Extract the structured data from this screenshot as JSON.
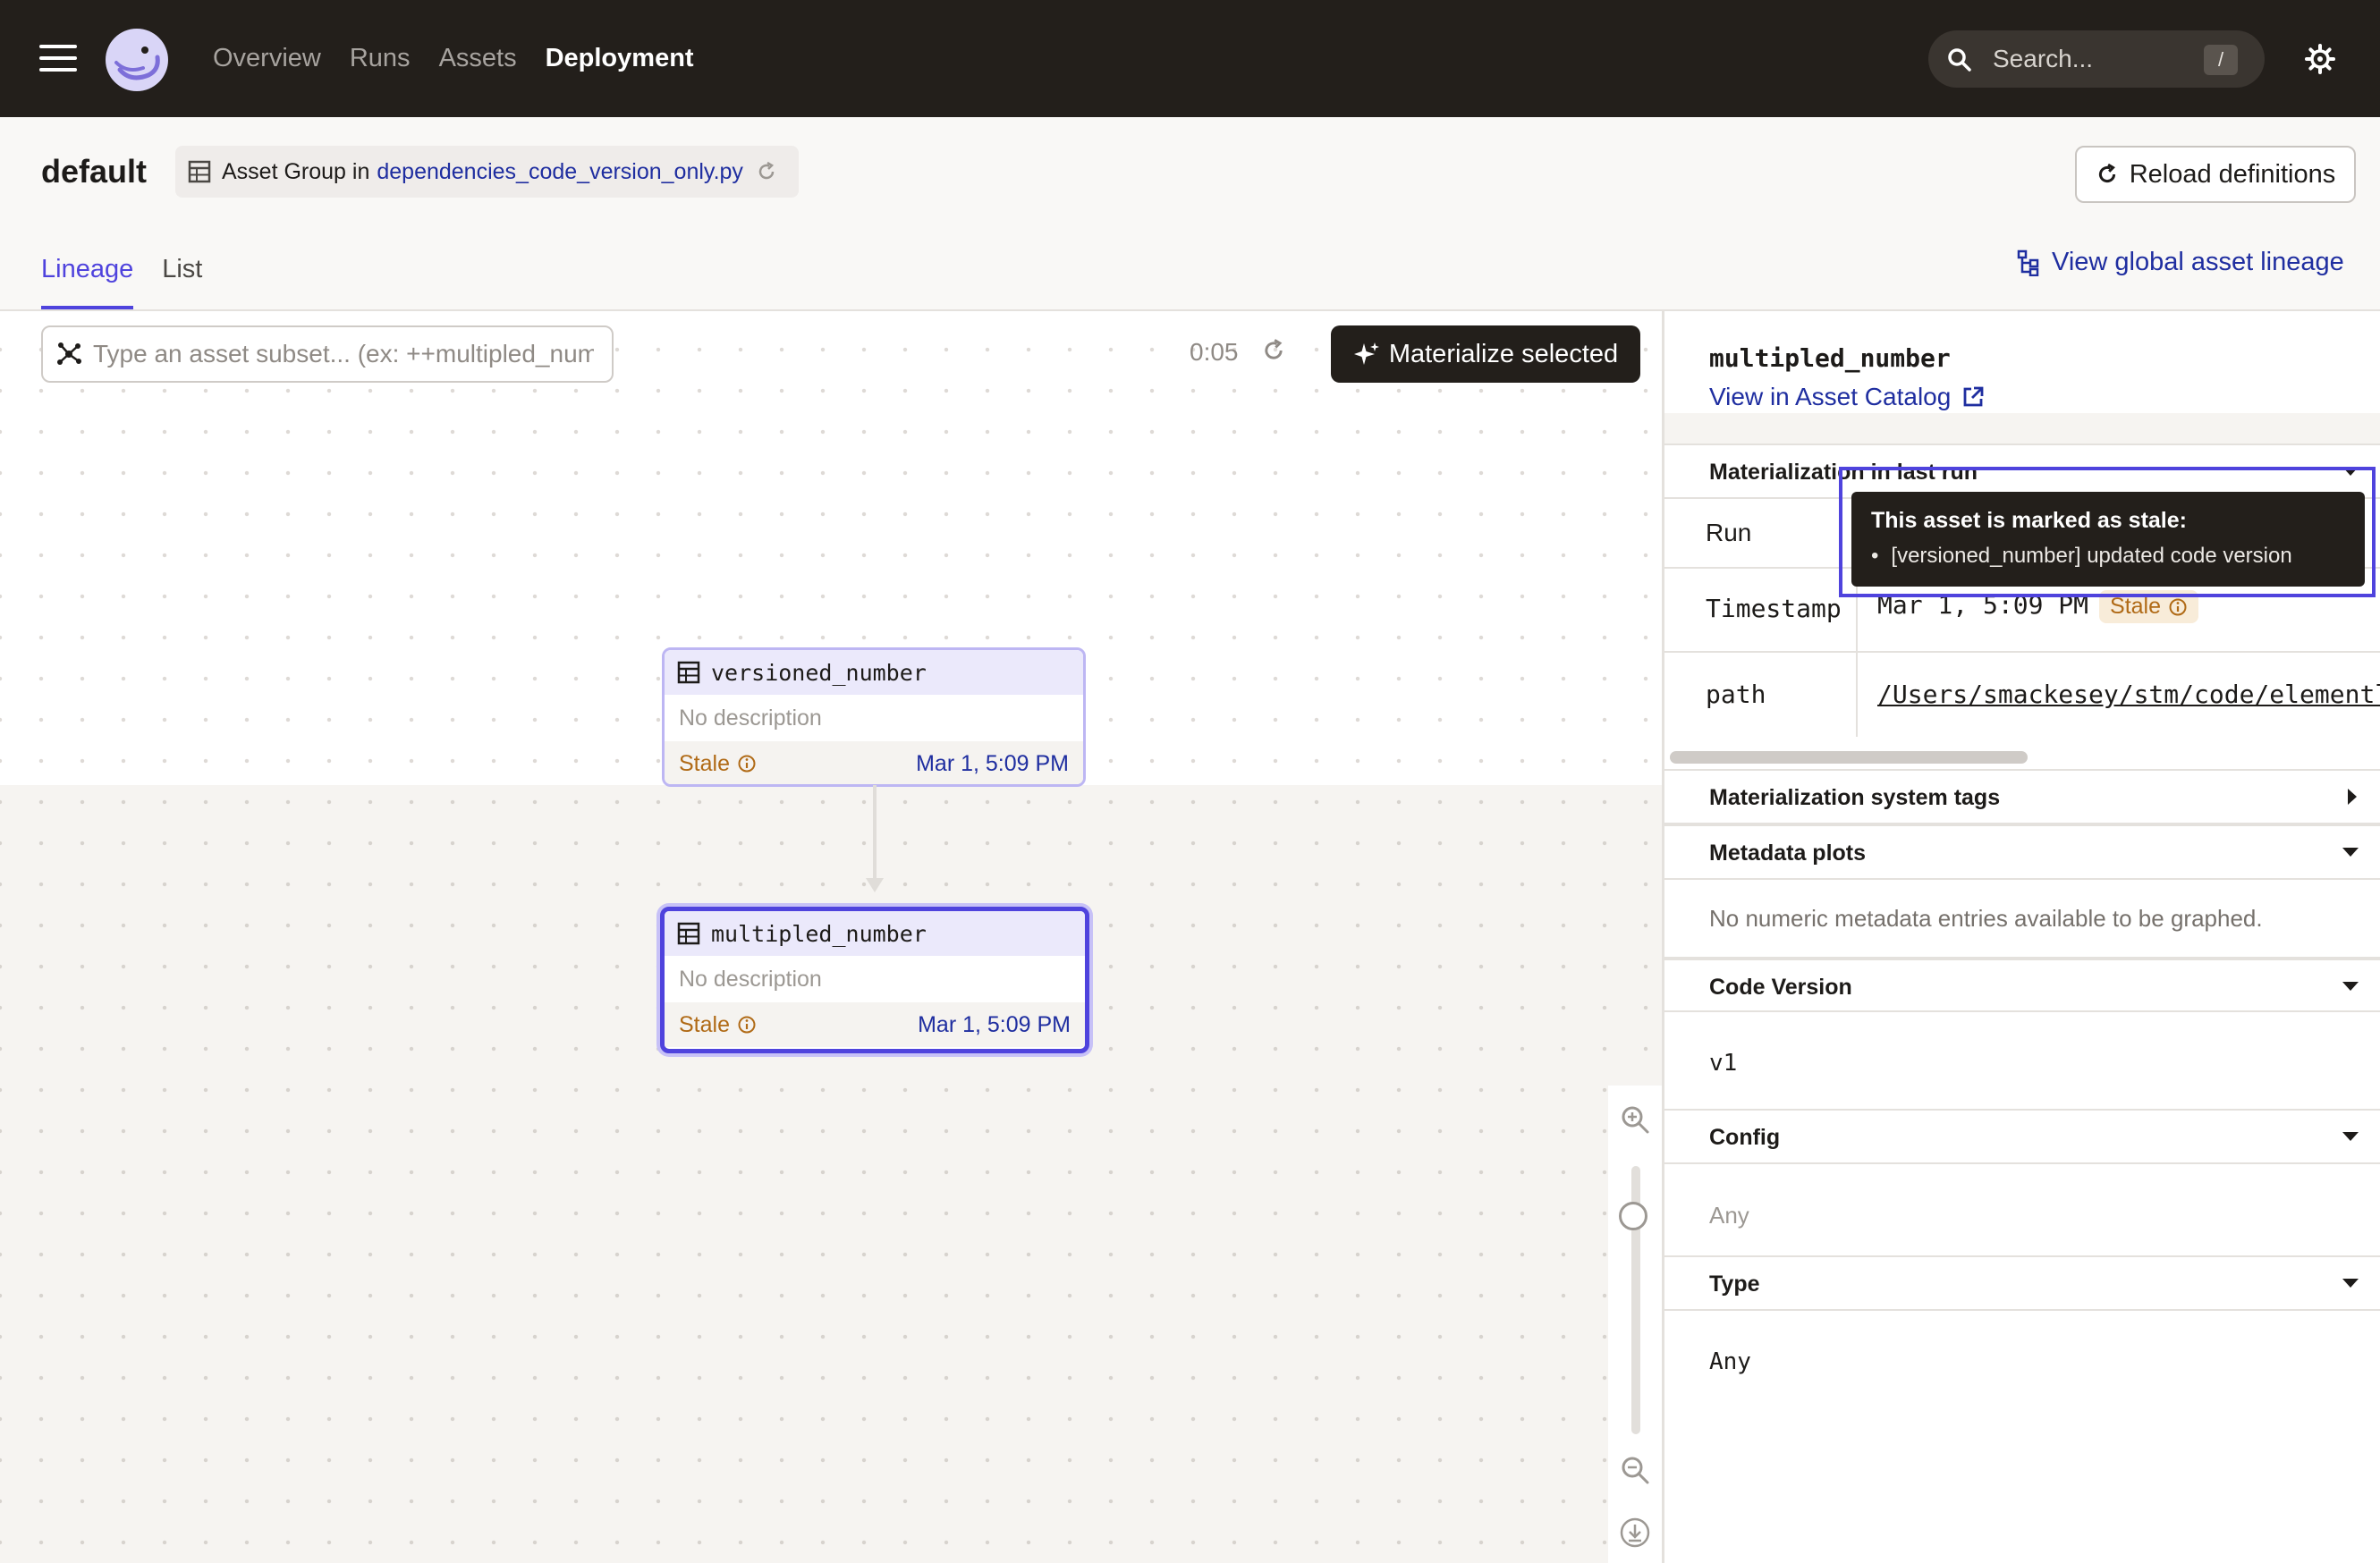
{
  "nav": {
    "items": [
      "Overview",
      "Runs",
      "Assets",
      "Deployment"
    ],
    "search_placeholder": "Search...",
    "search_shortcut": "/"
  },
  "header": {
    "title": "default",
    "group_prefix": "Asset Group in",
    "group_location": "dependencies_code_version_only.py",
    "reload_label": "Reload definitions",
    "tabs": [
      "Lineage",
      "List"
    ],
    "global_lineage_label": "View global asset lineage"
  },
  "canvas": {
    "asset_input_placeholder": "Type an asset subset... (ex: ++multipled_number+)",
    "timer": "0:05",
    "materialize_label": "Materialize selected",
    "nodes": [
      {
        "name": "versioned_number",
        "description": "No description",
        "status": "Stale",
        "timestamp": "Mar 1, 5:09 PM"
      },
      {
        "name": "multipled_number",
        "description": "No description",
        "status": "Stale",
        "timestamp": "Mar 1, 5:09 PM"
      }
    ]
  },
  "panel": {
    "asset_name": "multipled_number",
    "catalog_link": "View in Asset Catalog",
    "materialization_section": "Materialization in last run",
    "rows": [
      {
        "key": "Run",
        "value": ""
      },
      {
        "key": "Timestamp",
        "value": "Mar 1, 5:09 PM",
        "badge": "Stale"
      },
      {
        "key": "path",
        "value": "/Users/smackesey/stm/code/elementl/"
      }
    ],
    "system_tags_section": "Materialization system tags",
    "plots_section": "Metadata plots",
    "plots_empty": "No numeric metadata entries available to be graphed.",
    "code_version_section": "Code Version",
    "code_version_value": "v1",
    "config_section": "Config",
    "config_value": "Any",
    "type_section": "Type",
    "type_value": "Any"
  },
  "tooltip": {
    "title": "This asset is marked as stale:",
    "item": "[versioned_number] updated code version"
  },
  "colors": {
    "accent": "#4f43dd",
    "nav_bg": "#231f1b",
    "link": "#1f2ea0",
    "stale": "#b06a16"
  }
}
